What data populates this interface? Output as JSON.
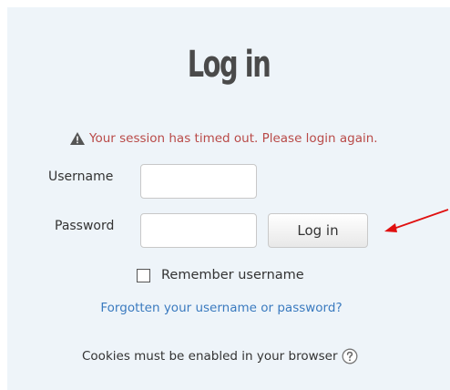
{
  "login": {
    "title": "Log in",
    "error_message": "Your session has timed out. Please login again.",
    "username_label": "Username",
    "password_label": "Password",
    "username_value": "",
    "password_value": "",
    "submit_label": "Log in",
    "remember_label": "Remember username",
    "remember_checked": false,
    "forgot_link": "Forgotten your username or password?",
    "cookies_notice": "Cookies must be enabled in your browser"
  },
  "icons": {
    "warning": "warning-triangle-icon",
    "help": "help-circle-icon",
    "annotation": "red-arrow"
  },
  "colors": {
    "error": "#b94a48",
    "link": "#3a7abf",
    "arrow": "#e01010",
    "panel": "#eef4f9"
  }
}
